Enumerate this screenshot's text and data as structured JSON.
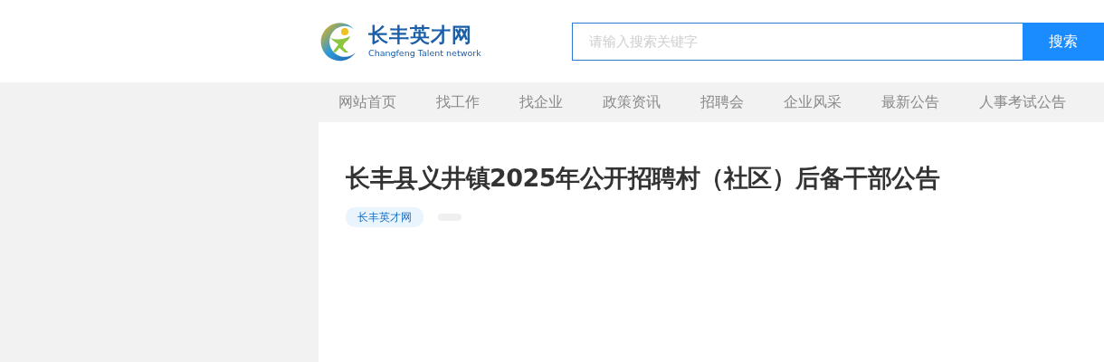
{
  "logo": {
    "name": "长丰英才网",
    "subtitle": "Changfeng Talent network"
  },
  "search": {
    "placeholder": "请输入搜索关键字",
    "button": "搜索"
  },
  "nav": [
    {
      "label": "网站首页"
    },
    {
      "label": "找工作"
    },
    {
      "label": "找企业"
    },
    {
      "label": "政策资讯"
    },
    {
      "label": "招聘会"
    },
    {
      "label": "企业风采"
    },
    {
      "label": "最新公告"
    },
    {
      "label": "人事考试公告"
    }
  ],
  "article": {
    "title": "长丰县义井镇2025年公开招聘村（社区）后备干部公告",
    "source_tag": "长丰英才网",
    "meta_empty": true
  }
}
